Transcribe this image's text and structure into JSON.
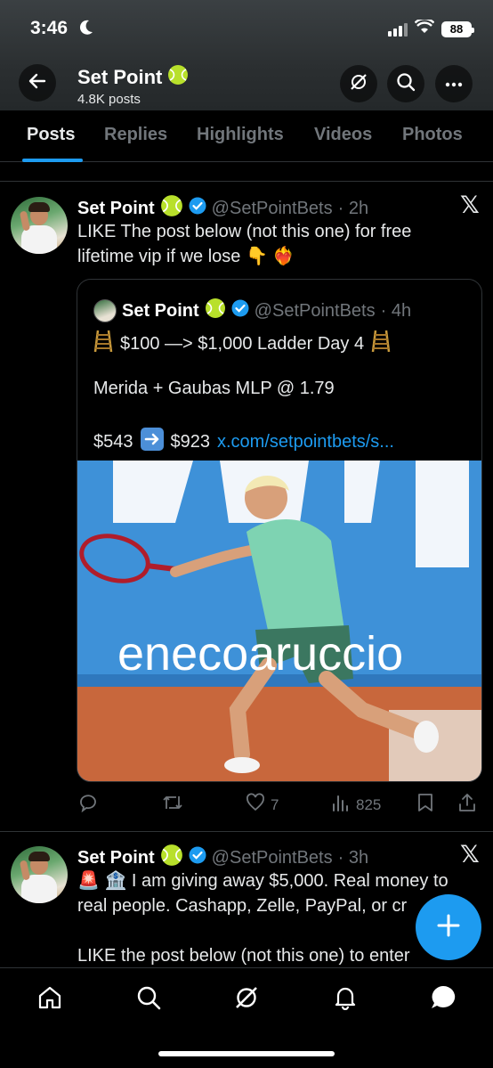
{
  "status_bar": {
    "time": "3:46",
    "battery": "88"
  },
  "header": {
    "title": "Set Point",
    "subtitle": "4.8K posts"
  },
  "tabs": [
    {
      "label": "Posts",
      "active": true
    },
    {
      "label": "Replies"
    },
    {
      "label": "Highlights"
    },
    {
      "label": "Videos"
    },
    {
      "label": "Photos"
    }
  ],
  "posts": [
    {
      "name": "Set Point",
      "handle": "@SetPointBets",
      "time": "· 2h",
      "text_line1": "LIKE The post below (not this one) for free",
      "text_line2": "lifetime vip if we lose 👇 ❤️‍🔥",
      "quote": {
        "name": "Set Point",
        "handle": "@SetPointBets",
        "time": "· 4h",
        "line1": "$100 —> $1,000 Ladder Day 4",
        "line2": "Merida + Gaubas MLP @ 1.79",
        "line3_prefix": "$543",
        "line3_mid": "$923",
        "line3_link": "x.com/setpointbets/s..."
      },
      "stats": {
        "replies": "",
        "reposts": "",
        "likes": "7",
        "views": "825"
      }
    },
    {
      "name": "Set Point",
      "handle": "@SetPointBets",
      "time": "· 3h",
      "text_line1": "🚨 🏦 I am giving away $5,000. Real money to",
      "text_line2": "real people. Cashapp, Zelle, PayPal, or cr",
      "text_line3": "LIKE the post below (not this one) to enter"
    }
  ],
  "photo": {
    "banner_text": "enecoaruccio"
  },
  "colors": {
    "accent": "#1d9bf0",
    "muted": "#71767b",
    "verified": "#1d9bf0"
  },
  "icons": [
    "back-arrow-icon",
    "grok-icon",
    "search-icon",
    "more-icon",
    "x-logo-icon",
    "reply-icon",
    "repost-icon",
    "like-icon",
    "views-icon",
    "bookmark-icon",
    "share-icon",
    "compose-icon",
    "home-icon",
    "explore-icon",
    "notifications-icon",
    "messages-icon"
  ]
}
